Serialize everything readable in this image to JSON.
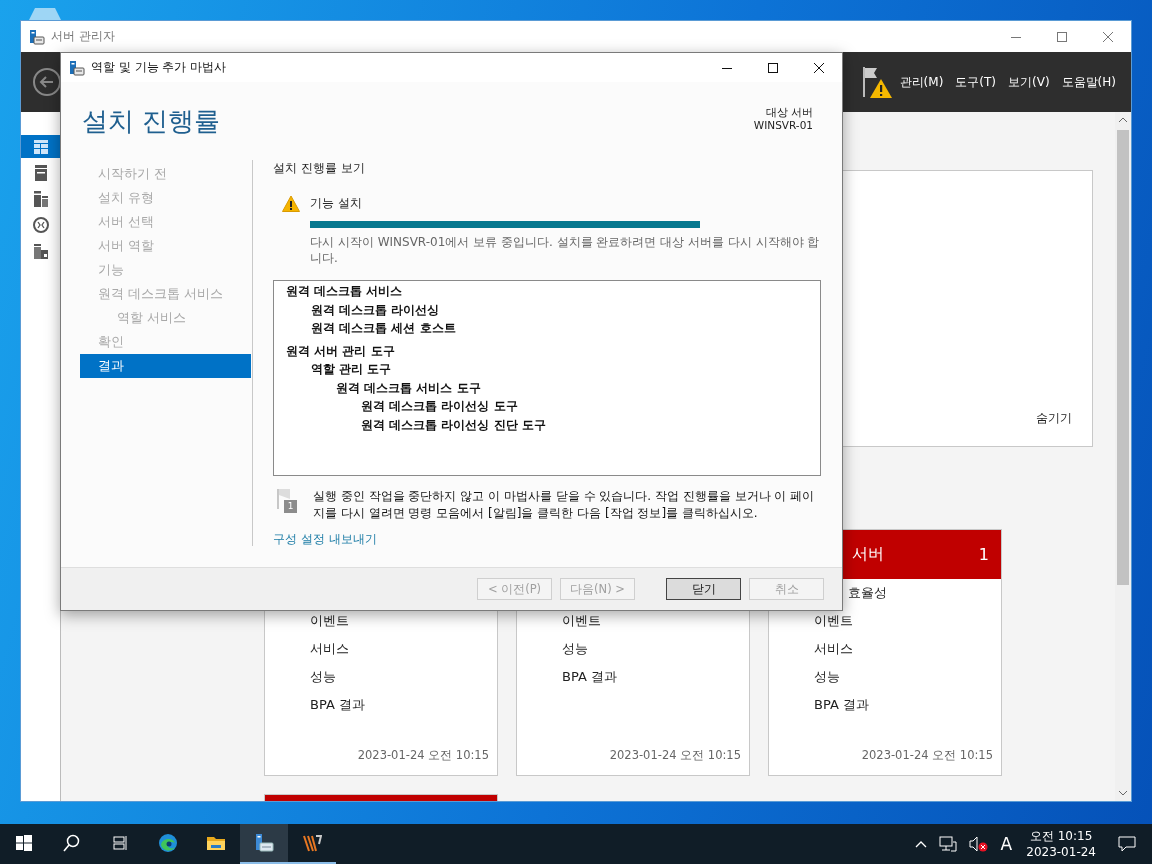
{
  "server_manager": {
    "title": "서버 관리자",
    "menu": [
      "관리(M)",
      "도구(T)",
      "보기(V)",
      "도움말(H)"
    ],
    "nav_items": [
      {
        "kind": "dashboard",
        "selected": true
      },
      {
        "kind": "local-server",
        "selected": false
      },
      {
        "kind": "all-servers",
        "selected": false
      },
      {
        "kind": "remote-desktop",
        "selected": false
      },
      {
        "kind": "file-storage",
        "selected": false
      }
    ],
    "panel": {
      "hide_link": "숨기기"
    },
    "tiles": [
      {
        "rows": [
          "이벤트",
          "서비스",
          "성능",
          "BPA 결과"
        ],
        "timestamp": "2023-01-24 오전 10:15"
      },
      {
        "rows": [
          "이벤트",
          "성능",
          "BPA 결과"
        ],
        "timestamp": "2023-01-24 오전 10:15"
      },
      {
        "color": "#c00000",
        "title": "서버",
        "count": "1",
        "rows": [
          "효율성",
          "이벤트",
          "서비스",
          "성능",
          "BPA 결과"
        ],
        "timestamp": "2023-01-24 오전 10:15"
      },
      {
        "color": "#c00000"
      }
    ]
  },
  "wizard": {
    "title": "역할 및 기능 추가 마법사",
    "heading": "설치 진행률",
    "target_label": "대상 서버",
    "target_server": "WINSVR-01",
    "steps": [
      {
        "label": "시작하기 전",
        "selected": false
      },
      {
        "label": "설치 유형",
        "selected": false
      },
      {
        "label": "서버 선택",
        "selected": false
      },
      {
        "label": "서버 역할",
        "selected": false
      },
      {
        "label": "기능",
        "selected": false
      },
      {
        "label": "원격 데스크톱 서비스",
        "selected": false,
        "children": [
          {
            "label": "역할 서비스",
            "selected": false
          }
        ]
      },
      {
        "label": "확인",
        "selected": false
      },
      {
        "label": "결과",
        "selected": true
      }
    ],
    "section_title": "설치 진행률 보기",
    "status": {
      "kind": "warning",
      "label": "기능 설치",
      "level": 1,
      "message": "다시 시작이 WINSVR-01에서 보류 중입니다. 설치를 완료하려면 대상 서버를 다시 시작해야 합니다."
    },
    "results": [
      {
        "label": "원격 데스크톱 서비스",
        "children": [
          {
            "label": "원격 데스크톱 라이선싱"
          },
          {
            "label": "원격 데스크톱 세션 호스트"
          }
        ]
      },
      {
        "label": "원격 서버 관리 도구",
        "children": [
          {
            "label": "역할 관리 도구",
            "children": [
              {
                "label": "원격 데스크톱 서비스 도구",
                "children": [
                  {
                    "label": "원격 데스크톱 라이선싱 도구"
                  },
                  {
                    "label": "원격 데스크톱 라이선싱 진단 도구"
                  }
                ]
              }
            ]
          }
        ]
      }
    ],
    "note_badge": "1",
    "note": "실행 중인 작업을 중단하지 않고 이 마법사를 닫을 수 있습니다. 작업 진행률을 보거나 이 페이지를 다시 열려면 명령 모음에서 [알림]을 클릭한 다음 [작업 정보]를 클릭하십시오.",
    "export_link": "구성 설정 내보내기",
    "buttons": [
      {
        "label": "< 이전(P)",
        "kind": "nav",
        "disabled": true,
        "default": false
      },
      {
        "label": "다음(N) >",
        "kind": "nav",
        "disabled": true,
        "default": false
      },
      {
        "label": "닫기",
        "kind": "action",
        "disabled": false,
        "default": true
      },
      {
        "label": "취소",
        "kind": "action",
        "disabled": true,
        "default": false
      }
    ]
  },
  "taskbar": {
    "buttons": [
      {
        "kind": "start",
        "active": false,
        "running": false
      },
      {
        "kind": "search",
        "active": false,
        "running": false
      },
      {
        "kind": "task-view",
        "active": false,
        "running": false
      },
      {
        "kind": "browser",
        "active": false,
        "running": false
      },
      {
        "kind": "folder",
        "active": false,
        "running": false
      },
      {
        "kind": "server-manager",
        "active": true,
        "running": true
      },
      {
        "kind": "stripes",
        "active": false,
        "running": true
      }
    ],
    "ime": "A",
    "time": "오전 10:15",
    "date": "2023-01-24"
  }
}
